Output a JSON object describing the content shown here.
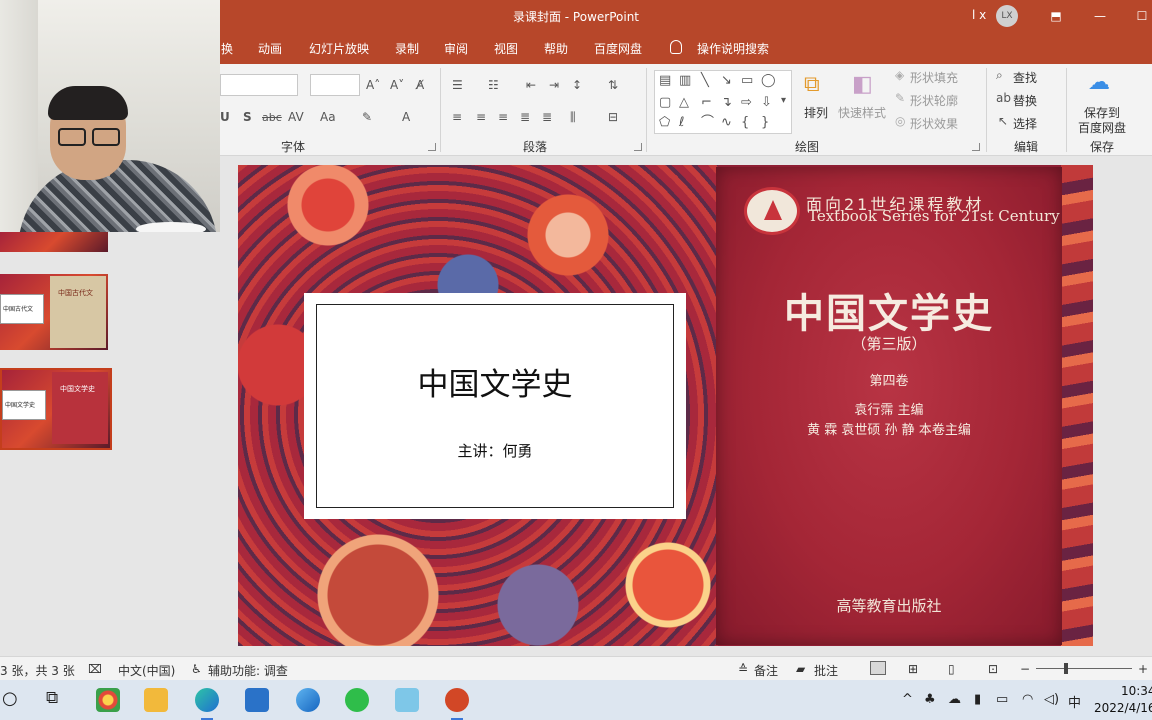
{
  "window": {
    "title": "录课封面 - PowerPoint",
    "user_initials": "LX",
    "user_short": "l x"
  },
  "tabs": [
    "换",
    "动画",
    "幻灯片放映",
    "录制",
    "审阅",
    "视图",
    "帮助",
    "百度网盘",
    "操作说明搜索"
  ],
  "ribbon": {
    "font_group": "字体",
    "paragraph_group": "段落",
    "drawing_group": "绘图",
    "editing_group": "编辑",
    "save_group": "保存",
    "arrange": "排列",
    "quick_styles": "快速样式",
    "shape_fill": "形状填充",
    "shape_outline": "形状轮廓",
    "shape_effects": "形状效果",
    "find": "查找",
    "replace": "替换",
    "select": "选择",
    "save_baidu_line1": "保存到",
    "save_baidu_line2": "百度网盘",
    "font_buttons": [
      "U",
      "S",
      "abc",
      "AV",
      "Aa",
      "A"
    ]
  },
  "thumbnails": [
    {
      "label": "",
      "book": ""
    },
    {
      "label": "中国古代文",
      "book": "中国古代文"
    },
    {
      "label": "中国文学史",
      "book": "中国文学史"
    }
  ],
  "slide": {
    "title": "中国文学史",
    "subtitle": "主讲：何勇"
  },
  "book": {
    "series_cn": "面向21世纪课程教材",
    "series_en": "Textbook Series for 21st Century",
    "title": "中国文学史",
    "edition": "（第三版）",
    "volume": "第四卷",
    "editor": "袁行霈  主编",
    "vol_editors": "黄  霖  袁世硕  孙  静  本卷主编",
    "publisher": "高等教育出版社"
  },
  "status": {
    "slide_count": "3 张，共 3 张",
    "language": "中文(中国)",
    "accessibility": "辅助功能: 调查",
    "notes": "备注",
    "comments": "批注"
  },
  "taskbar": {
    "time": "10:34",
    "date": "2022/4/16",
    "ime": "中"
  },
  "colors": {
    "accent": "#b7472a",
    "taskbar": "#dde6f0"
  }
}
